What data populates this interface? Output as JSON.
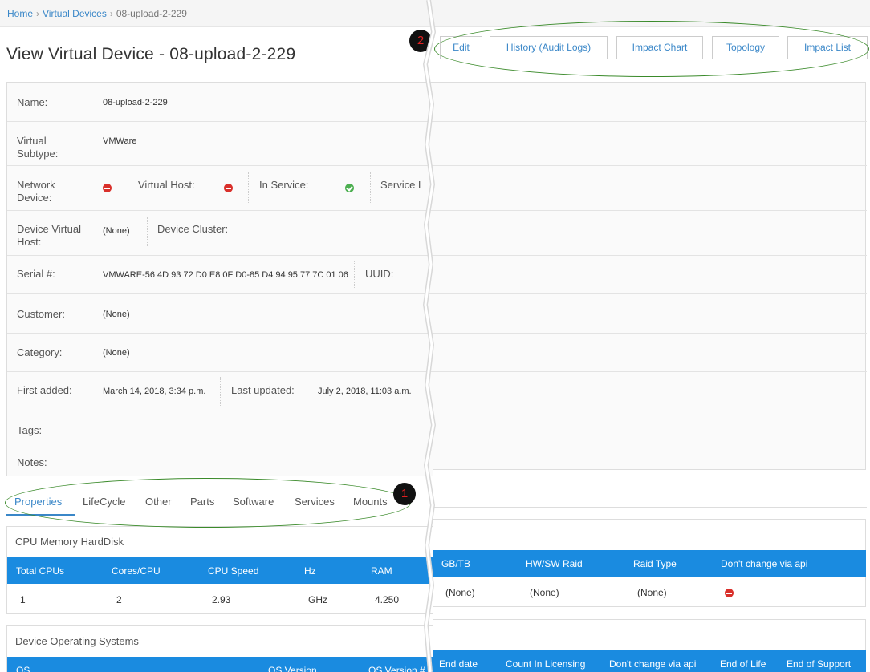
{
  "breadcrumb": {
    "home": "Home",
    "section": "Virtual Devices",
    "current": "08-upload-2-229",
    "separator": "›"
  },
  "page_title": "View Virtual Device - 08-upload-2-229",
  "actions": {
    "edit": "Edit",
    "history": "History (Audit Logs)",
    "impact_chart": "Impact Chart",
    "topology": "Topology",
    "impact_list": "Impact List"
  },
  "annotations": {
    "one": "1",
    "two": "2"
  },
  "details": {
    "name_label": "Name:",
    "name_value": "08-upload-2-229",
    "subtype_label": "Virtual Subtype:",
    "subtype_value": "VMWare",
    "network_label": "Network Device:",
    "network_state": "no",
    "vhost_label": "Virtual Host:",
    "vhost_state": "no",
    "inservice_label": "In Service:",
    "inservice_state": "yes",
    "servicelevel_label": "Service L",
    "dvhost_label": "Device Virtual Host:",
    "dvhost_value": "(None)",
    "cluster_label": "Device Cluster:",
    "serial_label": "Serial #:",
    "serial_value": "VMWARE-56 4D 93 72 D0 E8 0F D0-85 D4 94 95 77 7C 01 06",
    "uuid_label": "UUID:",
    "customer_label": "Customer:",
    "customer_value": "(None)",
    "category_label": "Category:",
    "category_value": "(None)",
    "first_added_label": "First added:",
    "first_added_value": "March 14, 2018, 3:34 p.m.",
    "last_updated_label": "Last updated:",
    "last_updated_value": "July 2, 2018, 11:03 a.m.",
    "tags_label": "Tags:",
    "notes_label": "Notes:"
  },
  "tabs": [
    "Properties",
    "LifeCycle",
    "Other",
    "Parts",
    "Software",
    "Services",
    "Mounts"
  ],
  "active_tab": "Properties",
  "hw": {
    "title": "CPU Memory HardDisk",
    "headers_left": [
      "Total CPUs",
      "Cores/CPU",
      "CPU Speed",
      "Hz",
      "RAM"
    ],
    "row_left": [
      "1",
      "2",
      "2.93",
      "GHz",
      "4.250"
    ],
    "headers_right": [
      "GB/TB",
      "HW/SW Raid",
      "Raid Type",
      "Don't change via api"
    ],
    "row_right": [
      "(None)",
      "(None)",
      "(None)"
    ],
    "api_locked": "no"
  },
  "os": {
    "title": "Device Operating Systems",
    "headers_left": [
      "OS",
      "OS Version",
      "OS Version #"
    ],
    "headers_right": [
      "End date",
      "Count In Licensing",
      "Don't change via api",
      "End of Life",
      "End of Support"
    ]
  },
  "colors": {
    "accent": "#1a8be0",
    "link": "#3a87c8",
    "error": "#d9302b",
    "ok": "#4caf50",
    "annotation": "#3a8a2a"
  }
}
